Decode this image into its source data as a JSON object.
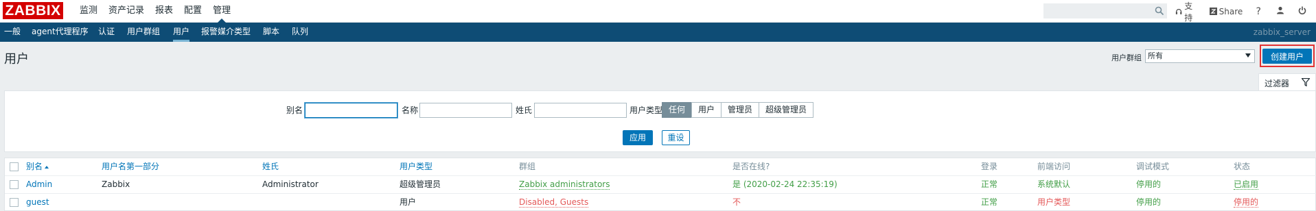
{
  "header": {
    "logo": "ZABBIX",
    "menu": [
      "监测",
      "资产记录",
      "报表",
      "配置",
      "管理"
    ],
    "active_menu": 4,
    "search_value": "",
    "support_label": "支持",
    "share_label": "Share",
    "help_label": "?"
  },
  "subnav": {
    "items": [
      "一般",
      "agent代理程序",
      "认证",
      "用户群组",
      "用户",
      "报警媒介类型",
      "脚本",
      "队列"
    ],
    "active_item": 4,
    "server_name": "zabbix_server"
  },
  "page": {
    "title": "用户",
    "usergroup_label": "用户群组",
    "usergroup_value": "所有",
    "create_button": "创建用户"
  },
  "filter": {
    "tab_label": "过滤器",
    "alias_label": "别名",
    "alias_value": "",
    "name_label": "名称",
    "name_value": "",
    "surname_label": "姓氏",
    "surname_value": "",
    "type_label": "用户类型",
    "type_options": [
      "任何",
      "用户",
      "管理员",
      "超级管理员"
    ],
    "type_selected": "任何",
    "apply_label": "应用",
    "reset_label": "重设"
  },
  "table": {
    "columns": [
      "别名",
      "用户名第一部分",
      "姓氏",
      "用户类型",
      "群组",
      "是否在线?",
      "登录",
      "前端访问",
      "调试模式",
      "状态"
    ],
    "rows": [
      {
        "alias": "Admin",
        "name": "Zabbix",
        "surname": "Administrator",
        "type": "超级管理员",
        "groups": "Zabbix administrators",
        "online": "是 (2020-02-24 22:35:19)",
        "login": "正常",
        "frontend": "系统默认",
        "debug": "停用的",
        "status": "已启用"
      },
      {
        "alias": "guest",
        "name": "",
        "surname": "",
        "type": "用户",
        "groups": "Disabled, Guests",
        "online": "不",
        "login": "正常",
        "frontend": "用户类型",
        "debug": "停用的",
        "status": "停用的"
      }
    ]
  },
  "colors": {
    "brand": "#d40000",
    "nav": "#0e4c75",
    "accent": "#0275b8",
    "ok": "#429e47",
    "problem": "#e45959"
  }
}
